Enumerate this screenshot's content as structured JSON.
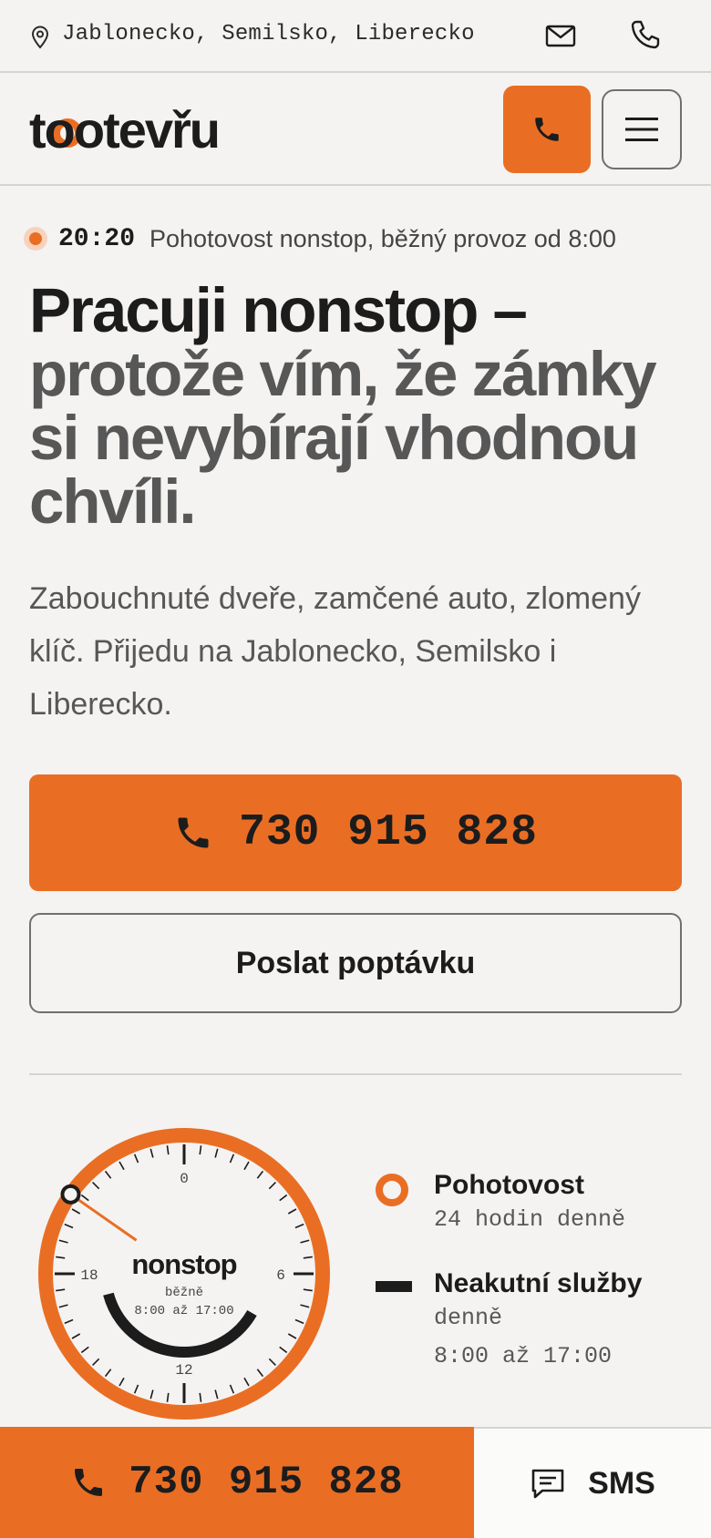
{
  "topbar": {
    "region": "Jablonecko, Semilsko, Liberecko",
    "icons": {
      "location": "map-pin-icon",
      "mail": "mail-icon",
      "phone": "phone-icon"
    }
  },
  "header": {
    "logo_text": "tootevřu",
    "icons": {
      "call": "phone-icon",
      "menu": "hamburger-menu-icon"
    }
  },
  "status": {
    "time": "20:20",
    "text": "Pohotovost nonstop, běžný provoz od 8:00"
  },
  "hero": {
    "title_line1": "Pracuji nonstop –",
    "title_line2": "protože vím, že zámky si nevybírají vhodnou chvíli.",
    "description": "Zabouchnuté dveře, zamčené auto, zlomený klíč. Přijedu na Jablonecko, Semilsko i Liberecko.",
    "phone_number": "730 915 828",
    "form_button": "Poslat poptávku"
  },
  "clock": {
    "center_label": "nonstop",
    "sub_label": "běžně",
    "sub_hours": "8:00 až 17:00",
    "hour_labels": {
      "top": "0",
      "right": "6",
      "bottom": "12",
      "left": "18"
    },
    "current_time": "20:20",
    "regular_hours_start": 8,
    "regular_hours_end": 17
  },
  "legend": {
    "emergency_title": "Pohotovost",
    "emergency_sub": "24 hodin denně",
    "regular_title": "Neakutní služby",
    "regular_sub1": "denně",
    "regular_sub2": "8:00 až 17:00"
  },
  "bottom_bar": {
    "phone_number": "730 915 828",
    "sms_label": "SMS",
    "icons": {
      "call": "phone-icon",
      "sms": "message-icon"
    }
  },
  "colors": {
    "accent": "#e96e24",
    "background": "#f4f3f1",
    "text": "#1c1c1c",
    "muted": "#575757"
  }
}
